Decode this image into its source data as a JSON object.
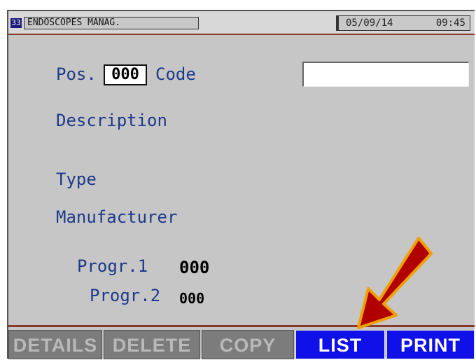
{
  "header": {
    "screen_id": "33",
    "title": "ENDOSCOPES MANAG.",
    "date": "05/09/14",
    "time": "09:45"
  },
  "form": {
    "pos_label": "Pos.",
    "pos_value": "000",
    "code_label": "Code",
    "code_value": "",
    "description_label": "Description",
    "type_label": "Type",
    "manufacturer_label": "Manufacturer",
    "progr1_label": "Progr.1",
    "progr1_value": "000",
    "progr2_label": "Progr.2",
    "progr2_value": "000"
  },
  "softkeys": [
    {
      "label": "DETAILS",
      "active": false
    },
    {
      "label": "DELETE",
      "active": false
    },
    {
      "label": "COPY",
      "active": false
    },
    {
      "label": "LIST",
      "active": true
    },
    {
      "label": "PRINT",
      "active": true
    }
  ],
  "colors": {
    "arrow_fill": "#b00000",
    "arrow_outline": "#f0a000",
    "active_key": "#1010e8"
  },
  "icons": {
    "pointer": "arrow-pointer-icon"
  }
}
